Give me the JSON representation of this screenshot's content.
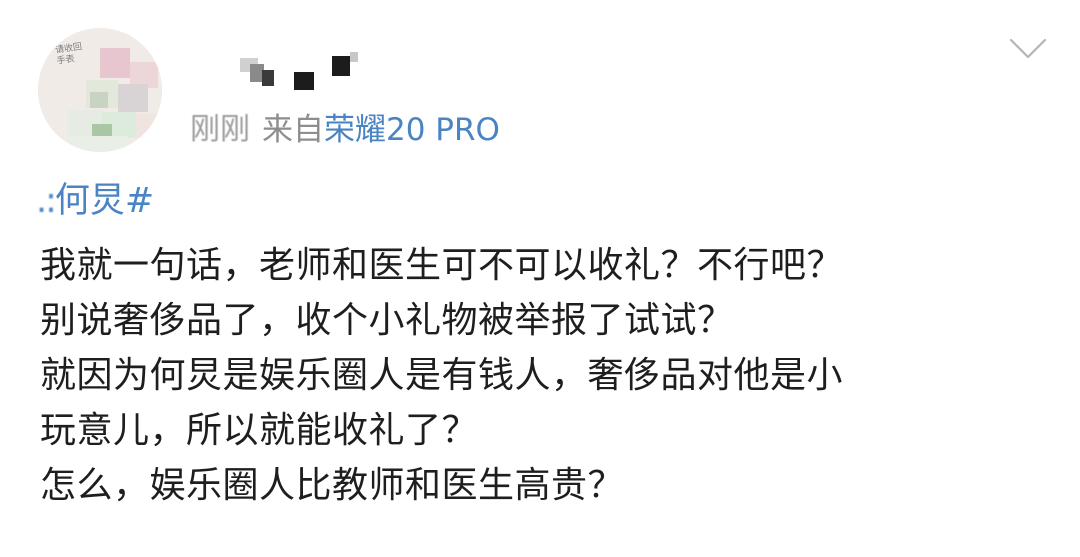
{
  "post": {
    "author": {
      "avatar_scribble": [
        "请收回",
        "手表"
      ]
    },
    "meta": {
      "time": "刚刚",
      "from_label": "来自",
      "device": "荣耀20 PRO"
    },
    "topic": "#何炅#",
    "topic_visible_edge": ".:",
    "topic_visible_text": "何炅#",
    "body_lines": [
      "我就一句话，老师和医生可不可以收礼？不行吧？",
      "别说奢侈品了，收个小礼物被举报了试试？",
      "就因为何炅是娱乐圈人是有钱人，奢侈品对他是小",
      "玩意儿，所以就能收礼了？",
      "怎么，娱乐圈人比教师和医生高贵？"
    ]
  },
  "icons": {
    "menu": "chevron-down-icon"
  },
  "colors": {
    "link": "#4a84c2",
    "meta_gray": "#8e8e8e",
    "text": "#1e1e1e",
    "chevron": "#b5b5b5"
  }
}
